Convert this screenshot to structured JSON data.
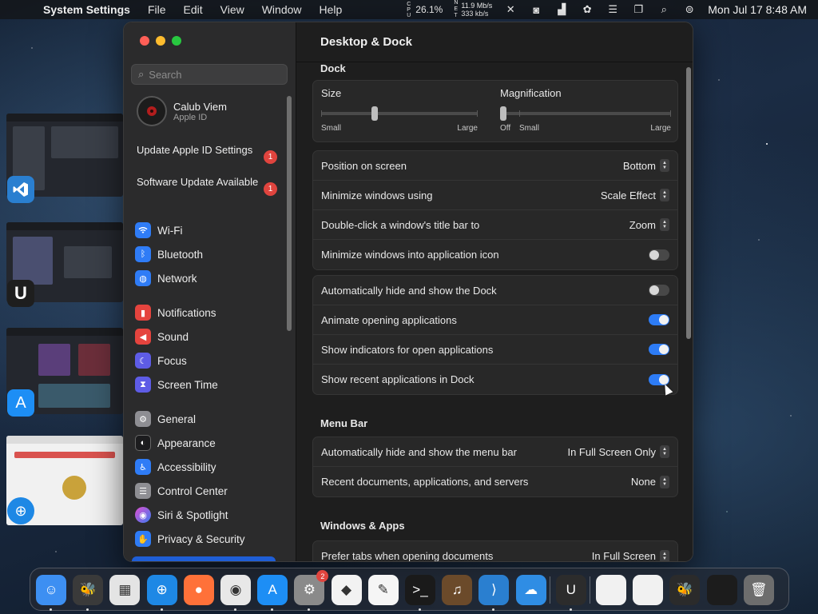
{
  "menubar": {
    "app_name": "System Settings",
    "menus": [
      "File",
      "Edit",
      "View",
      "Window",
      "Help"
    ],
    "cpu_letters": [
      "C",
      "P",
      "U"
    ],
    "cpu_percent": "26.1%",
    "net_letters": [
      "N",
      "E",
      "T"
    ],
    "net_up": "11.9 Mb/s",
    "net_down": "333 kb/s",
    "clock": "Mon Jul 17  8:48 AM"
  },
  "sidebar": {
    "search_placeholder": "Search",
    "user_name": "Calub Viem",
    "user_sub": "Apple ID",
    "notices": [
      {
        "label": "Update Apple ID Settings",
        "badge": "1"
      },
      {
        "label": "Software Update Available",
        "badge": "1"
      }
    ],
    "items": [
      {
        "label": "Wi-Fi",
        "icon": "wifi-icon",
        "color": "#2f7cf6"
      },
      {
        "label": "Bluetooth",
        "icon": "bluetooth-icon",
        "color": "#2f7cf6"
      },
      {
        "label": "Network",
        "icon": "globe-icon",
        "color": "#2f7cf6"
      },
      {
        "label": "Notifications",
        "icon": "bell-icon",
        "color": "#e5443e"
      },
      {
        "label": "Sound",
        "icon": "speaker-icon",
        "color": "#e5443e"
      },
      {
        "label": "Focus",
        "icon": "moon-icon",
        "color": "#5e5ce6"
      },
      {
        "label": "Screen Time",
        "icon": "hourglass-icon",
        "color": "#5e5ce6"
      },
      {
        "label": "General",
        "icon": "gear-icon",
        "color": "#8e8e93"
      },
      {
        "label": "Appearance",
        "icon": "appearance-icon",
        "color": "#1c1c1e"
      },
      {
        "label": "Accessibility",
        "icon": "accessibility-icon",
        "color": "#2f7cf6"
      },
      {
        "label": "Control Center",
        "icon": "control-center-icon",
        "color": "#8e8e93"
      },
      {
        "label": "Siri & Spotlight",
        "icon": "siri-icon",
        "color": "#b44bd8"
      },
      {
        "label": "Privacy & Security",
        "icon": "hand-icon",
        "color": "#2f7cf6"
      }
    ]
  },
  "content": {
    "title": "Desktop & Dock",
    "dock_section": "Dock",
    "size": {
      "label": "Size",
      "min": "Small",
      "max": "Large",
      "value": 0.33
    },
    "magnification": {
      "label": "Magnification",
      "off": "Off",
      "min": "Small",
      "max": "Large",
      "value": 0.0
    },
    "dock_rows": [
      {
        "label": "Position on screen",
        "type": "popup",
        "value": "Bottom"
      },
      {
        "label": "Minimize windows using",
        "type": "popup",
        "value": "Scale Effect"
      },
      {
        "label": "Double-click a window's title bar to",
        "type": "popup",
        "value": "Zoom"
      },
      {
        "label": "Minimize windows into application icon",
        "type": "toggle",
        "on": false
      }
    ],
    "dock_toggles": [
      {
        "label": "Automatically hide and show the Dock",
        "on": false
      },
      {
        "label": "Animate opening applications",
        "on": true
      },
      {
        "label": "Show indicators for open applications",
        "on": true
      },
      {
        "label": "Show recent applications in Dock",
        "on": true
      }
    ],
    "menu_bar_section": "Menu Bar",
    "menu_bar_rows": [
      {
        "label": "Automatically hide and show the menu bar",
        "value": "In Full Screen Only"
      },
      {
        "label": "Recent documents, applications, and servers",
        "value": "None"
      }
    ],
    "windows_section": "Windows & Apps",
    "windows_rows": [
      {
        "label": "Prefer tabs when opening documents",
        "value": "In Full Screen"
      }
    ]
  },
  "dock": {
    "apps": [
      {
        "name": "finder",
        "color": "#3d8ff2",
        "glyph": "☺",
        "running": true
      },
      {
        "name": "bee-app",
        "color": "#3a3a3a",
        "glyph": "🐝",
        "running": true
      },
      {
        "name": "launchpad",
        "color": "#e4e4e4",
        "glyph": "▦",
        "running": false
      },
      {
        "name": "safari",
        "color": "#1e88e5",
        "glyph": "⊕",
        "running": true
      },
      {
        "name": "firefox",
        "color": "#ff7139",
        "glyph": "●",
        "running": false
      },
      {
        "name": "chrome",
        "color": "#e8e8e8",
        "glyph": "◉",
        "running": true
      },
      {
        "name": "app-store",
        "color": "#1d8ef5",
        "glyph": "A",
        "running": true
      },
      {
        "name": "system-settings",
        "color": "#8a8a8a",
        "glyph": "⚙",
        "running": true,
        "badge": "2"
      },
      {
        "name": "visual-studio",
        "color": "#f2f2f2",
        "glyph": "◆",
        "running": false
      },
      {
        "name": "textedit",
        "color": "#f5f5f5",
        "glyph": "✎",
        "running": false
      },
      {
        "name": "terminal",
        "color": "#1a1a1a",
        "glyph": ">_",
        "running": true
      },
      {
        "name": "instruments",
        "color": "#6b4a2a",
        "glyph": "♫",
        "running": false
      },
      {
        "name": "vscode",
        "color": "#2a7fd0",
        "glyph": "⟩",
        "running": true
      },
      {
        "name": "weather",
        "color": "#2f8de4",
        "glyph": "☁",
        "running": false
      },
      {
        "name": "utm",
        "color": "#2c2c2c",
        "glyph": "U",
        "running": true
      },
      {
        "name": "minimized-window-1",
        "color": "#f1f1f1",
        "glyph": "",
        "running": false
      },
      {
        "name": "minimized-window-2",
        "color": "#f1f1f1",
        "glyph": "",
        "running": false
      },
      {
        "name": "minimized-window-3",
        "color": "#2b2b2b",
        "glyph": "🐝",
        "running": false
      },
      {
        "name": "minimized-window-4",
        "color": "#1c1c1c",
        "glyph": "",
        "running": false
      },
      {
        "name": "trash",
        "color": "#6d6d6d",
        "glyph": "🗑",
        "running": false
      }
    ]
  }
}
